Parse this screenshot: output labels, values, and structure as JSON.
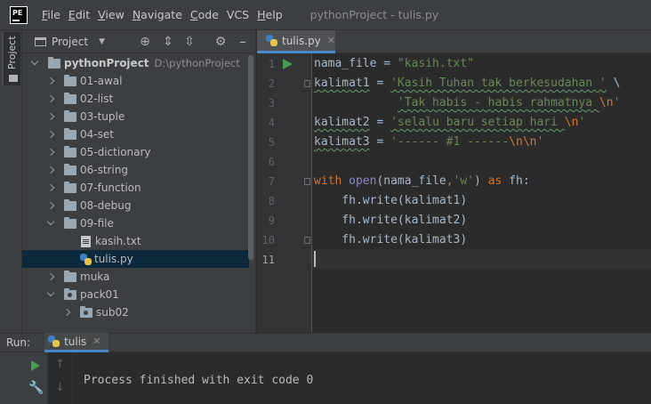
{
  "logo_text": "PE",
  "menu": [
    "File",
    "Edit",
    "View",
    "Navigate",
    "Code",
    "VCS",
    "Help"
  ],
  "menu_underline": [
    "F",
    "E",
    "V",
    "N",
    "C",
    "",
    "H"
  ],
  "window_title": "pythonProject - tulis.py",
  "side_tab": "Project",
  "project_panel": {
    "title": "Project"
  },
  "tree": [
    {
      "label": "pythonProject",
      "path": "D:\\pythonProject",
      "type": "folder",
      "arrow": "down",
      "depth": 0,
      "bold": true
    },
    {
      "label": "01-awal",
      "type": "folder",
      "arrow": "right",
      "depth": 1
    },
    {
      "label": "02-list",
      "type": "folder",
      "arrow": "right",
      "depth": 1
    },
    {
      "label": "03-tuple",
      "type": "folder",
      "arrow": "right",
      "depth": 1
    },
    {
      "label": "04-set",
      "type": "folder",
      "arrow": "right",
      "depth": 1
    },
    {
      "label": "05-dictionary",
      "type": "folder",
      "arrow": "right",
      "depth": 1
    },
    {
      "label": "06-string",
      "type": "folder",
      "arrow": "right",
      "depth": 1
    },
    {
      "label": "07-function",
      "type": "folder",
      "arrow": "right",
      "depth": 1
    },
    {
      "label": "08-debug",
      "type": "folder",
      "arrow": "right",
      "depth": 1
    },
    {
      "label": "09-file",
      "type": "folder",
      "arrow": "down",
      "depth": 1
    },
    {
      "label": "kasih.txt",
      "type": "text",
      "arrow": "none",
      "depth": 2
    },
    {
      "label": "tulis.py",
      "type": "python",
      "arrow": "none",
      "depth": 2,
      "selected": true
    },
    {
      "label": "muka",
      "type": "folder",
      "arrow": "right",
      "depth": 1
    },
    {
      "label": "pack01",
      "type": "package",
      "arrow": "down",
      "depth": 1
    },
    {
      "label": "sub02",
      "type": "package",
      "arrow": "right",
      "depth": 2
    }
  ],
  "editor_tab": {
    "label": "tulis.py",
    "close": "✕"
  },
  "line_numbers": [
    "1",
    "2",
    "3",
    "4",
    "5",
    "6",
    "7",
    "8",
    "9",
    "10",
    "11"
  ],
  "code": [
    [
      {
        "t": "nama_file = ",
        "c": ""
      },
      {
        "t": "\"kasih.txt\"",
        "c": "str"
      }
    ],
    [
      {
        "t": "kalimat1",
        "c": "spell"
      },
      {
        "t": " = ",
        "c": ""
      },
      {
        "t": "'Kasih Tuhan tak berkesudahan '",
        "c": "str spell"
      },
      {
        "t": " \\",
        "c": ""
      }
    ],
    [
      {
        "t": "            ",
        "c": ""
      },
      {
        "t": "'Tak habis - habis rahmatnya ",
        "c": "str spell"
      },
      {
        "t": "\\n",
        "c": "esc"
      },
      {
        "t": "'",
        "c": "str"
      }
    ],
    [
      {
        "t": "kalimat2",
        "c": "spell"
      },
      {
        "t": " = ",
        "c": ""
      },
      {
        "t": "'selalu baru setiap hari ",
        "c": "str spell"
      },
      {
        "t": "\\n",
        "c": "esc"
      },
      {
        "t": "'",
        "c": "str"
      }
    ],
    [
      {
        "t": "kalimat3",
        "c": "spell"
      },
      {
        "t": " = ",
        "c": ""
      },
      {
        "t": "'------ #1 ------",
        "c": "str"
      },
      {
        "t": "\\n\\n",
        "c": "esc"
      },
      {
        "t": "'",
        "c": "str"
      }
    ],
    [],
    [
      {
        "t": "with",
        "c": "kw"
      },
      {
        "t": " ",
        "c": ""
      },
      {
        "t": "open",
        "c": "bi"
      },
      {
        "t": "(nama_file",
        "c": ""
      },
      {
        "t": ",",
        "c": "esc"
      },
      {
        "t": "'w'",
        "c": "str"
      },
      {
        "t": ") ",
        "c": ""
      },
      {
        "t": "as",
        "c": "kw"
      },
      {
        "t": " fh:",
        "c": ""
      }
    ],
    [
      {
        "t": "    fh.write(kalimat1)",
        "c": ""
      }
    ],
    [
      {
        "t": "    fh.write(kalimat2)",
        "c": ""
      }
    ],
    [
      {
        "t": "    fh.write(kalimat3)",
        "c": ""
      }
    ],
    []
  ],
  "run_panel": {
    "label": "Run:",
    "tab_label": "tulis",
    "tab_close": "✕",
    "output": "Process finished with exit code 0"
  }
}
